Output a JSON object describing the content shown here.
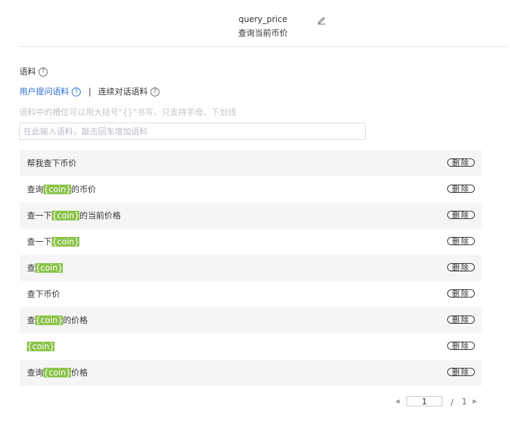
{
  "intent": {
    "name": "query_price",
    "description": "查询当前币价"
  },
  "icons": {
    "edit": "edit-pencil-icon",
    "help": "question-circle-icon",
    "prev": "caret-left-icon",
    "next": "caret-right-icon"
  },
  "corpus": {
    "title": "语料",
    "help_glyph": "?"
  },
  "tabs": [
    {
      "label": "用户提问语料",
      "active": true
    },
    {
      "label": "连续对话语料",
      "active": false
    }
  ],
  "tab_separator": "|",
  "hint": "语料中的槽位可以用大括号\"{}\"书写，只支持字母、下划线",
  "input": {
    "placeholder": "在此输入语料，敲击回车增加语料",
    "value": ""
  },
  "utterances": [
    {
      "parts": [
        {
          "text": "帮我查下币价",
          "slot": false
        }
      ]
    },
    {
      "parts": [
        {
          "text": "查询",
          "slot": false
        },
        {
          "text": "{coin}",
          "slot": true
        },
        {
          "text": "的币价",
          "slot": false
        }
      ]
    },
    {
      "parts": [
        {
          "text": "查一下",
          "slot": false
        },
        {
          "text": "{coin}",
          "slot": true
        },
        {
          "text": "的当前价格",
          "slot": false
        }
      ]
    },
    {
      "parts": [
        {
          "text": "查一下",
          "slot": false
        },
        {
          "text": "{coin}",
          "slot": true
        }
      ]
    },
    {
      "parts": [
        {
          "text": "查",
          "slot": false
        },
        {
          "text": "{coin}",
          "slot": true
        }
      ]
    },
    {
      "parts": [
        {
          "text": "查下币价",
          "slot": false
        }
      ]
    },
    {
      "parts": [
        {
          "text": "查",
          "slot": false
        },
        {
          "text": "{coin}",
          "slot": true
        },
        {
          "text": "的价格",
          "slot": false
        }
      ]
    },
    {
      "parts": [
        {
          "text": "{coin}",
          "slot": true
        }
      ]
    },
    {
      "parts": [
        {
          "text": "查询",
          "slot": false
        },
        {
          "text": "{coin}",
          "slot": true
        },
        {
          "text": "价格",
          "slot": false
        }
      ]
    }
  ],
  "delete_label": "删除",
  "pagination": {
    "current": "1",
    "separator": "/",
    "total": "1"
  },
  "colors": {
    "accent": "#2f6fd6",
    "slot_highlight": "#8bc34a",
    "row_stripe": "#f5f5f5"
  }
}
